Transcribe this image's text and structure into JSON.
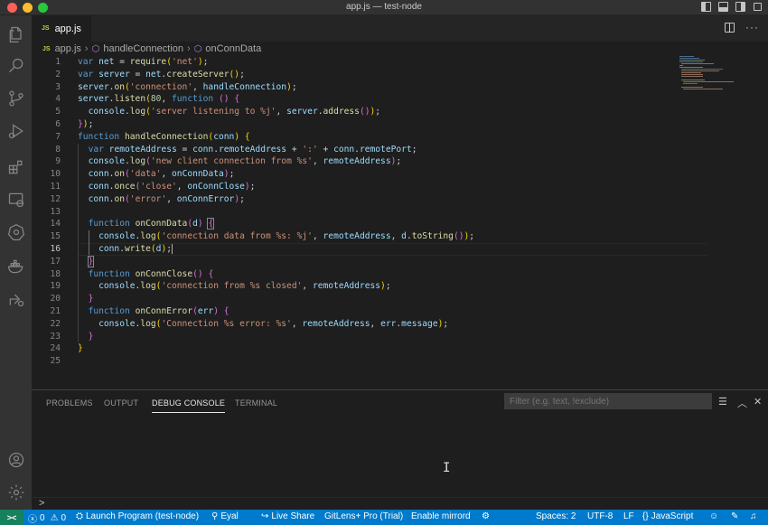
{
  "window": {
    "title": "app.js — test-node"
  },
  "tabs": [
    {
      "icon": "JS",
      "label": "app.js"
    }
  ],
  "breadcrumb": {
    "file_icon": "JS",
    "file": "app.js",
    "symbol1": "handleConnection",
    "symbol2": "onConnData"
  },
  "editor": {
    "current_line": 16,
    "lines": [
      {
        "n": "1"
      },
      {
        "n": "2"
      },
      {
        "n": "3"
      },
      {
        "n": "4"
      },
      {
        "n": "5"
      },
      {
        "n": "6"
      },
      {
        "n": "7"
      },
      {
        "n": "8"
      },
      {
        "n": "9"
      },
      {
        "n": "10"
      },
      {
        "n": "11"
      },
      {
        "n": "12"
      },
      {
        "n": "13"
      },
      {
        "n": "14"
      },
      {
        "n": "15"
      },
      {
        "n": "16"
      },
      {
        "n": "17"
      },
      {
        "n": "18"
      },
      {
        "n": "19"
      },
      {
        "n": "20"
      },
      {
        "n": "21"
      },
      {
        "n": "22"
      },
      {
        "n": "23"
      },
      {
        "n": "24"
      },
      {
        "n": "25"
      }
    ]
  },
  "panel": {
    "tabs": [
      "PROBLEMS",
      "OUTPUT",
      "DEBUG CONSOLE",
      "TERMINAL"
    ],
    "active_tab": "DEBUG CONSOLE",
    "filter_placeholder": "Filter (e.g. text, !exclude)",
    "repl_prompt": ">"
  },
  "statusbar": {
    "remote": "><",
    "errors": "0",
    "warnings": "0",
    "launch": "Launch Program (test-node)",
    "author": "Eyal",
    "live_share": "Live Share",
    "gitlens": "GitLens+ Pro (Trial)",
    "mirrord": "Enable mirrord",
    "spaces": "Spaces: 2",
    "encoding": "UTF-8",
    "eol": "LF",
    "language": "JavaScript"
  },
  "colors": {
    "accent": "#007acc",
    "remote": "#16825d",
    "editor_bg": "#1e1e1e",
    "activity_bg": "#333333"
  },
  "icons": {
    "activity": [
      "explorer-icon",
      "search-icon",
      "source-control-icon",
      "run-debug-icon",
      "extensions-icon",
      "remote-explorer-icon",
      "kubernetes-icon",
      "docker-icon",
      "live-share-icon",
      "accounts-icon",
      "manage-gear-icon"
    ]
  }
}
